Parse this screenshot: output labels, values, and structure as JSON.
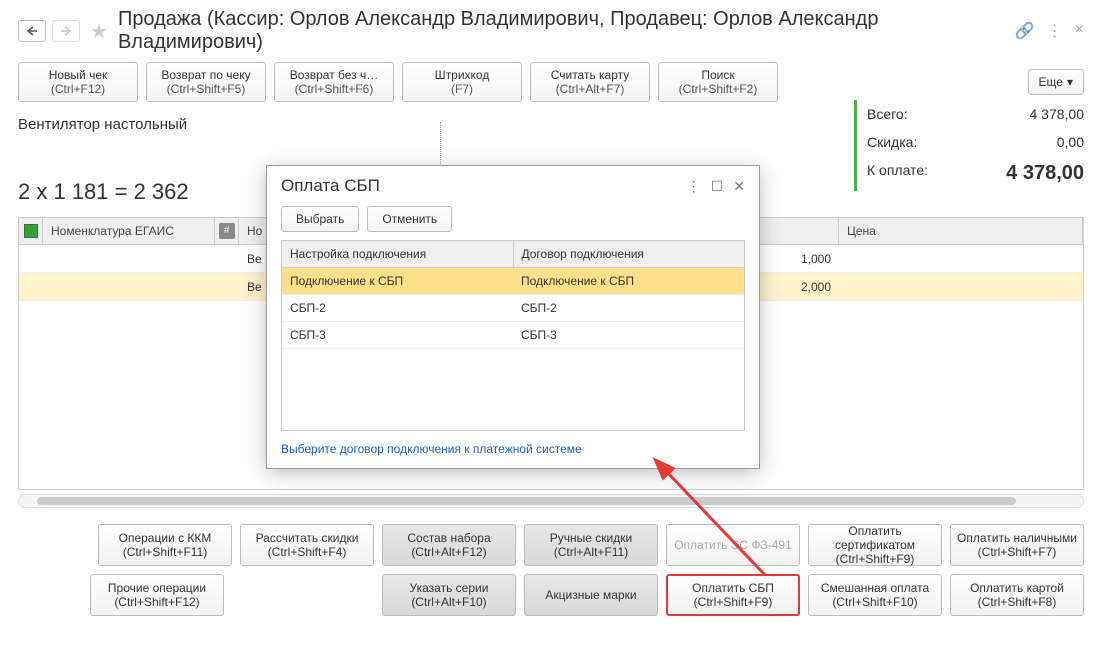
{
  "header": {
    "title": "Продажа (Кассир: Орлов Александр Владимирович, Продавец: Орлов Александр Владимирович)"
  },
  "toolbar": {
    "new_check": {
      "label": "Новый чек",
      "shortcut": "(Ctrl+F12)"
    },
    "return_check": {
      "label": "Возврат по чеку",
      "shortcut": "(Ctrl+Shift+F5)"
    },
    "return_no": {
      "label": "Возврат без ч…",
      "shortcut": "(Ctrl+Shift+F6)"
    },
    "barcode": {
      "label": "Штрихкод",
      "shortcut": "(F7)"
    },
    "read_card": {
      "label": "Считать карту",
      "shortcut": "(Ctrl+Alt+F7)"
    },
    "search": {
      "label": "Поиск",
      "shortcut": "(Ctrl+Shift+F2)"
    },
    "more": "Еще"
  },
  "item_name": "Вентилятор настольный",
  "price_calc": "2 x 1 181 = 2 362",
  "totals": {
    "total_label": "Всего:",
    "total_value": "4 378,00",
    "discount_label": "Скидка:",
    "discount_value": "0,00",
    "due_label": "К оплате:",
    "due_value": "4 378,00"
  },
  "table": {
    "egais_header": "Номенклатура ЕГАИС",
    "nom_header": "Но",
    "price_header": "Цена",
    "rows": [
      {
        "name": "Ве",
        "qty": "1,000"
      },
      {
        "name": "Ве",
        "qty": "2,000"
      }
    ]
  },
  "modal": {
    "title": "Оплата СБП",
    "select": "Выбрать",
    "cancel": "Отменить",
    "col1": "Настройка подключения",
    "col2": "Договор подключения",
    "rows": [
      {
        "a": "Подключение к СБП",
        "b": "Подключение к СБП"
      },
      {
        "a": "СБП-2",
        "b": "СБП-2"
      },
      {
        "a": "СБП-3",
        "b": "СБП-3"
      }
    ],
    "link": "Выберите договор подключения к платежной системе"
  },
  "bottom": {
    "row1": [
      {
        "l1": "Операции с ККМ",
        "l2": "(Ctrl+Shift+F11)",
        "style": ""
      },
      {
        "l1": "Рассчитать скидки",
        "l2": "(Ctrl+Shift+F4)",
        "style": ""
      },
      {
        "l1": "Состав набора",
        "l2": "(Ctrl+Alt+F12)",
        "style": "dark"
      },
      {
        "l1": "Ручные скидки",
        "l2": "(Ctrl+Alt+F11)",
        "style": "dark"
      },
      {
        "l1": "Оплатить ЭС ФЗ-491",
        "l2": "",
        "style": "disabled"
      },
      {
        "l1": "Оплатить сертификатом",
        "l2": "(Ctrl+Shift+F9)",
        "style": ""
      },
      {
        "l1": "Оплатить наличными",
        "l2": "(Ctrl+Shift+F7)",
        "style": ""
      }
    ],
    "row2": [
      {
        "l1": "Прочие операции",
        "l2": "(Ctrl+Shift+F12)",
        "style": ""
      },
      {
        "l1": "",
        "l2": "",
        "style": "spacer"
      },
      {
        "l1": "Указать серии",
        "l2": "(Ctrl+Alt+F10)",
        "style": "dark"
      },
      {
        "l1": "Акцизные марки",
        "l2": "",
        "style": "dark"
      },
      {
        "l1": "Оплатить СБП",
        "l2": "(Ctrl+Shift+F9)",
        "style": "highlight"
      },
      {
        "l1": "Смешанная оплата",
        "l2": "(Ctrl+Shift+F10)",
        "style": ""
      },
      {
        "l1": "Оплатить картой",
        "l2": "(Ctrl+Shift+F8)",
        "style": ""
      }
    ]
  }
}
